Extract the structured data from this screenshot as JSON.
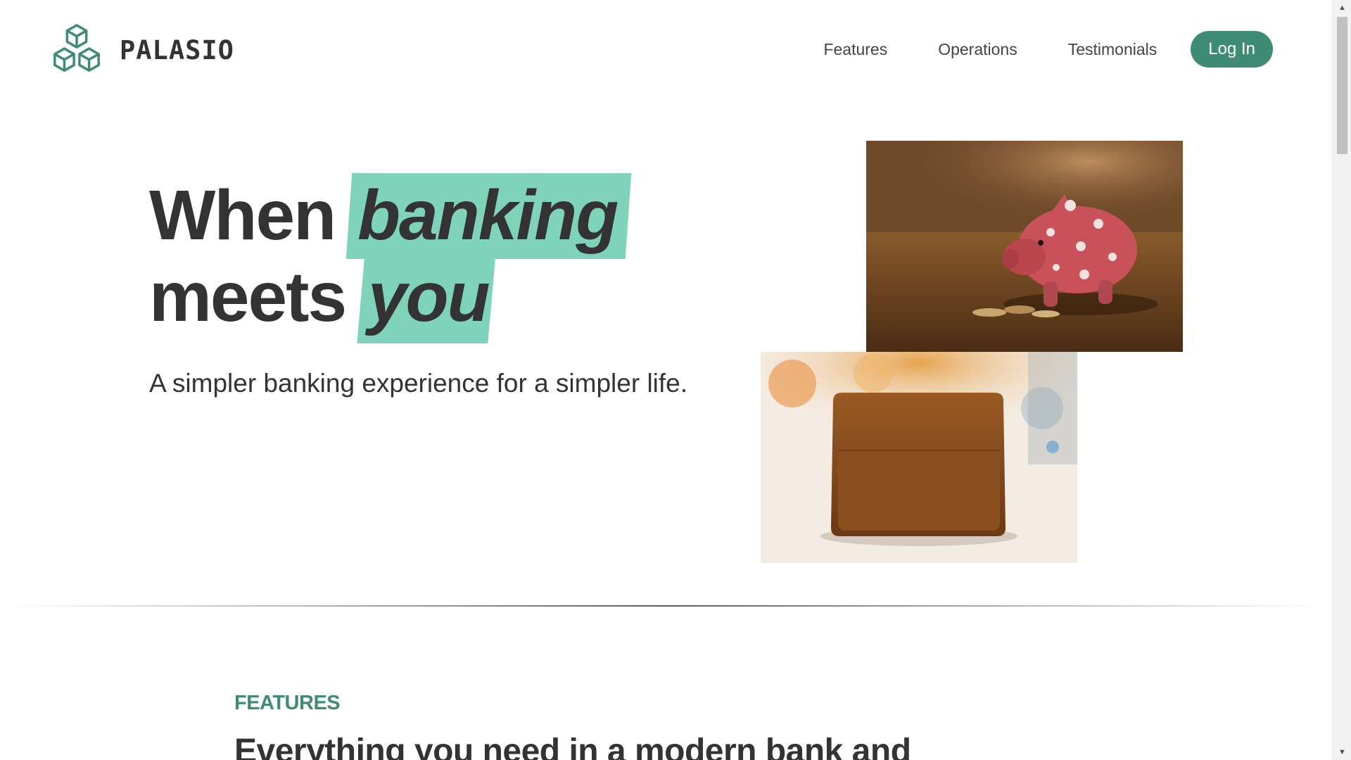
{
  "brand": {
    "name": "PALASIO",
    "logo_icon": "cubes-icon",
    "accent_color": "#3f8b73",
    "highlight_color": "#7ed3ba"
  },
  "nav": {
    "links": [
      "Features",
      "Operations",
      "Testimonials"
    ],
    "login_label": "Log In"
  },
  "hero": {
    "title_line1_plain": "When ",
    "title_line1_highlight": "banking",
    "title_line2_plain": "meets ",
    "title_line2_highlight": "you",
    "subtitle": "A simpler banking experience for a simpler life.",
    "images": [
      "piggy-bank-photo",
      "wallet-with-cards-photo"
    ]
  },
  "features": {
    "label": "FEATURES",
    "heading": "Everything you need in a modern bank and"
  }
}
